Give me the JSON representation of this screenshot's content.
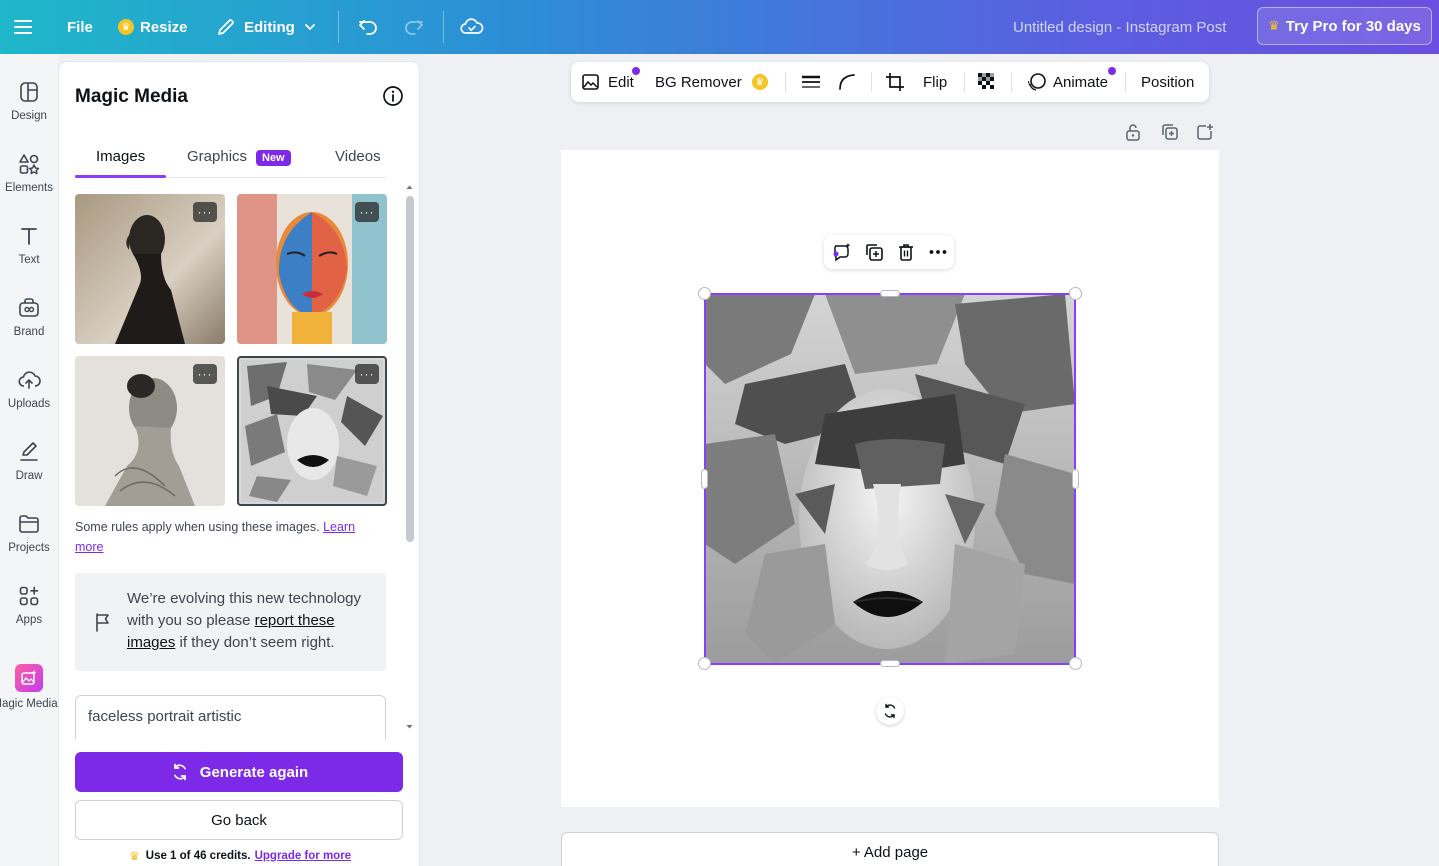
{
  "topbar": {
    "file_label": "File",
    "resize_label": "Resize",
    "editing_label": "Editing",
    "doc_title": "Untitled design - Instagram Post",
    "pro_label": "Try Pro for 30 days"
  },
  "rail": {
    "items": [
      {
        "label": "Design"
      },
      {
        "label": "Elements"
      },
      {
        "label": "Text"
      },
      {
        "label": "Brand"
      },
      {
        "label": "Uploads"
      },
      {
        "label": "Draw"
      },
      {
        "label": "Projects"
      },
      {
        "label": "Apps"
      },
      {
        "label": "Magic Media"
      }
    ]
  },
  "panel": {
    "title": "Magic Media",
    "tabs": [
      {
        "label": "Images"
      },
      {
        "label": "Graphics",
        "badge": "New"
      },
      {
        "label": "Videos"
      }
    ],
    "more_glyph": "···",
    "rules_text": "Some rules apply when using these images. ",
    "rules_link": "Learn more",
    "notice_before": "We’re evolving this new technology with you so please ",
    "notice_link": "report these images",
    "notice_after": " if they don’t seem right.",
    "prompt_value": "faceless portrait artistic",
    "generate_label": "Generate again",
    "back_label": "Go back",
    "credits_text": "Use 1 of 46 credits.",
    "credits_link": "Upgrade for more"
  },
  "context_toolbar": {
    "edit_label": "Edit",
    "bg_remover_label": "BG Remover",
    "flip_label": "Flip",
    "animate_label": "Animate",
    "position_label": "Position"
  },
  "canvas": {
    "add_page_label": "+ Add page"
  },
  "colors": {
    "accent": "#7d2ae8",
    "selection": "#8b3dff",
    "crown": "#f5c425"
  }
}
